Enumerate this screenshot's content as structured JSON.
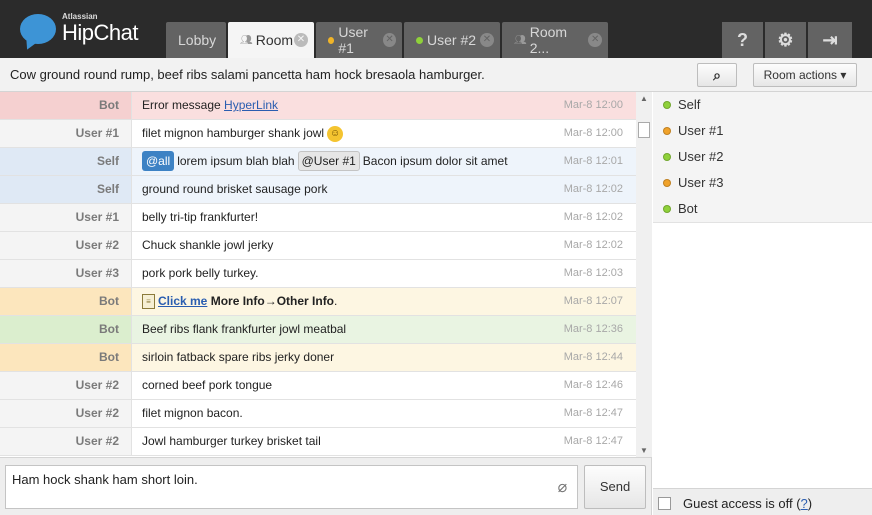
{
  "brand": {
    "small": "Atlassian",
    "name": "HipChat",
    "color": "#3d94d6"
  },
  "tabs": [
    {
      "label": "Lobby",
      "active": false,
      "status": null
    },
    {
      "label": "Room",
      "active": true,
      "status": null,
      "icon": "people-icon"
    },
    {
      "label": "User #1",
      "active": false,
      "status": "#f0b428"
    },
    {
      "label": "User #2",
      "active": false,
      "status": "#8fd13a"
    },
    {
      "label": "Room 2...",
      "active": false,
      "status": null,
      "icon": "people-icon"
    }
  ],
  "header_buttons": {
    "help": "?",
    "settings": "⚙",
    "logout": "⇥"
  },
  "topic": "Cow ground round rump, beef ribs salami pancetta ham hock bresaola hamburger.",
  "toolbar": {
    "search_icon": "⌕",
    "room_actions": "Room actions ▾"
  },
  "messages": [
    {
      "from": "Bot",
      "text": "Error message ",
      "link": "HyperLink",
      "time": "Mar-8 12:00",
      "style": "error"
    },
    {
      "from": "User #1",
      "text": "filet mignon hamburger shank jowl",
      "emoji": "☺",
      "time": "Mar-8 12:00",
      "style": "plain"
    },
    {
      "from": "Self",
      "mention_all": "@all",
      "text": "lorem ipsum blah blah",
      "mention_user": "@User #1",
      "text2": "Bacon ipsum dolor sit amet",
      "time": "Mar-8 12:01",
      "style": "self"
    },
    {
      "from": "Self",
      "text": "ground round brisket sausage pork",
      "time": "Mar-8 12:02",
      "style": "self"
    },
    {
      "from": "User #1",
      "text": "belly tri-tip frankfurter!",
      "time": "Mar-8 12:02",
      "style": "plain"
    },
    {
      "from": "User #2",
      "text": "Chuck shankle jowl jerky",
      "time": "Mar-8 12:02",
      "style": "plain"
    },
    {
      "from": "User #3",
      "text": "pork pork belly turkey.",
      "time": "Mar-8 12:03",
      "style": "plain"
    },
    {
      "from": "Bot",
      "link": "Click me",
      "text": " More Info→Other Info",
      "tail": ".",
      "time": "Mar-8 12:07",
      "style": "bot-yellow"
    },
    {
      "from": "Bot",
      "text": "Beef ribs flank frankfurter jowl meatbal",
      "time": "Mar-8 12:36",
      "style": "bot-green"
    },
    {
      "from": "Bot",
      "text": "sirloin fatback spare ribs jerky doner",
      "time": "Mar-8 12:44",
      "style": "bot-yellow"
    },
    {
      "from": "User #2",
      "text": "corned beef pork tongue",
      "time": "Mar-8 12:46",
      "style": "plain"
    },
    {
      "from": "User #2",
      "text": "filet mignon bacon.",
      "time": "Mar-8 12:47",
      "style": "plain"
    },
    {
      "from": "User #2",
      "text": "Jowl hamburger turkey brisket tail",
      "time": "Mar-8 12:47",
      "style": "plain"
    }
  ],
  "input": {
    "value": "Ham hock shank ham short loin.",
    "send": "Send"
  },
  "roster": [
    {
      "name": "Self",
      "status": "#8fd13a"
    },
    {
      "name": "User #1",
      "status": "#f0a22a"
    },
    {
      "name": "User #2",
      "status": "#8fd13a"
    },
    {
      "name": "User #3",
      "status": "#f0a22a"
    },
    {
      "name": "Bot",
      "status": "#8fd13a"
    }
  ],
  "guest": {
    "text": "Guest access is off (",
    "help": "?",
    "close": ")"
  }
}
